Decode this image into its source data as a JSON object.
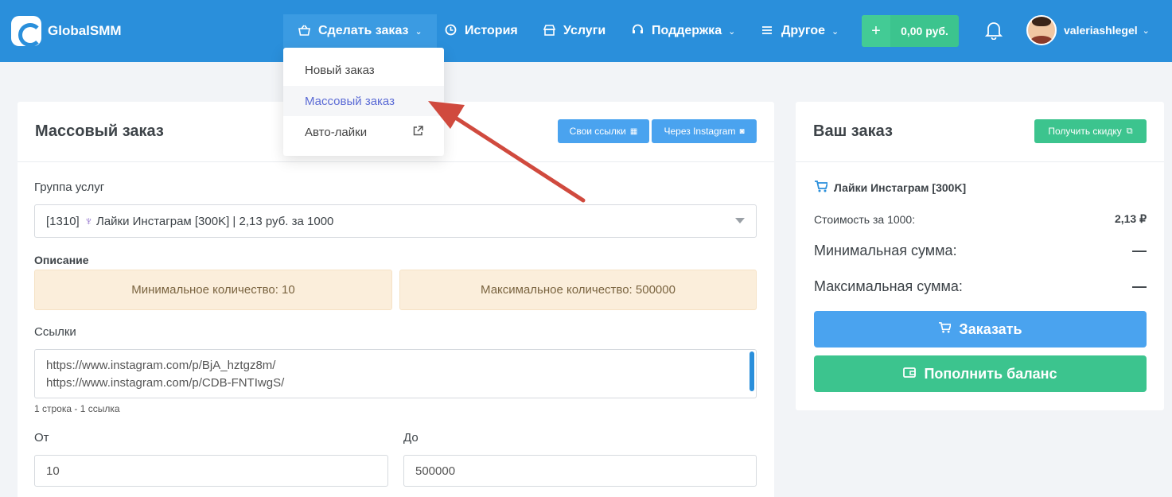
{
  "brand": {
    "name": "GlobalSMM"
  },
  "nav": {
    "order": {
      "label": "Сделать заказ",
      "icon": "shopping-basket-icon"
    },
    "history": {
      "label": "История",
      "icon": "clock-icon"
    },
    "services": {
      "label": "Услуги",
      "icon": "store-icon"
    },
    "support": {
      "label": "Поддержка",
      "icon": "headset-icon"
    },
    "other": {
      "label": "Другое",
      "icon": "menu-icon"
    },
    "balance": "0,00 руб.",
    "user": "valeriashlegel"
  },
  "dropdown": {
    "items": [
      {
        "label": "Новый заказ"
      },
      {
        "label": "Массовый заказ",
        "active": true
      },
      {
        "label": "Авто-лайки",
        "external": true
      }
    ]
  },
  "main": {
    "title": "Массовый заказ",
    "btn_own_links": "Свои ссылки",
    "btn_via_instagram": "Через Instagram",
    "group_label": "Группа услуг",
    "group_value_id": "[1310]",
    "group_value_text": "Лайки Инстаграм [300K] | 2,13 руб. за 1000",
    "description_label": "Описание",
    "min_qty": "Минимальное количество: 10",
    "max_qty": "Максимальное количество: 500000",
    "links_label": "Ссылки",
    "links": [
      "https://www.instagram.com/p/BjA_hztgz8m/",
      "https://www.instagram.com/p/CDB-FNTIwgS/"
    ],
    "links_hint": "1 строка - 1 ссылка",
    "from_label": "От",
    "from_value": "10",
    "to_label": "До",
    "to_value": "500000"
  },
  "side": {
    "title": "Ваш заказ",
    "discount_btn": "Получить скидку",
    "service_name": "Лайки Инстаграм [300K]",
    "price_label": "Стоимость за 1000:",
    "price_value": "2,13 ₽",
    "min_sum_label": "Минимальная сумма:",
    "min_sum_value": "—",
    "max_sum_label": "Максимальная сумма:",
    "max_sum_value": "—",
    "order_btn": "Заказать",
    "topup_btn": "Пополнить баланс"
  },
  "colors": {
    "topbar": "#2a8fdb",
    "accent_green": "#3cc48e",
    "accent_blue": "#4aa3ef",
    "annotation_arrow": "#d04a3e"
  }
}
